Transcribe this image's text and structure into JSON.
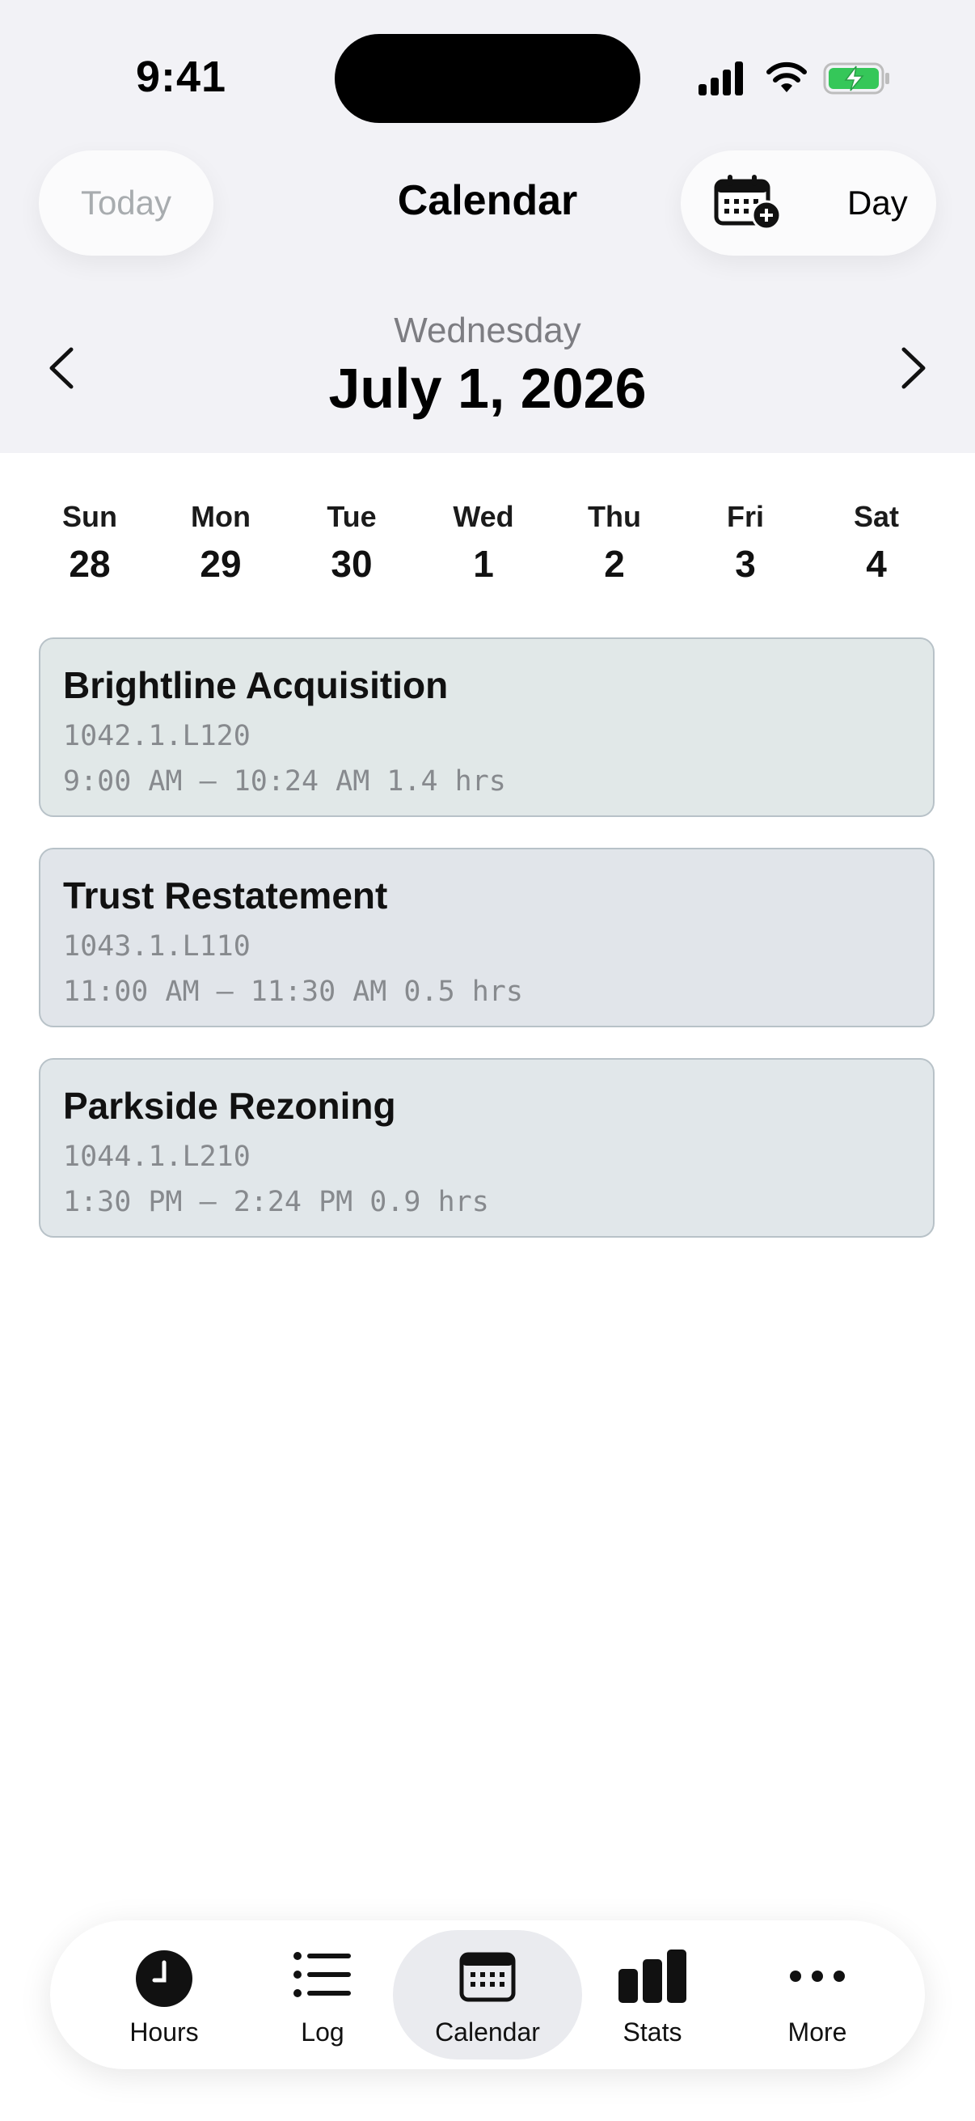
{
  "status_bar": {
    "time": "9:41"
  },
  "header": {
    "today_label": "Today",
    "title": "Calendar",
    "view_mode": "Day"
  },
  "date_nav": {
    "weekday": "Wednesday",
    "date": "July 1, 2026"
  },
  "week": [
    {
      "name": "Sun",
      "day": "28"
    },
    {
      "name": "Mon",
      "day": "29"
    },
    {
      "name": "Tue",
      "day": "30"
    },
    {
      "name": "Wed",
      "day": "1"
    },
    {
      "name": "Thu",
      "day": "2"
    },
    {
      "name": "Fri",
      "day": "3"
    },
    {
      "name": "Sat",
      "day": "4"
    }
  ],
  "events": [
    {
      "title": "Brightline Acquisition",
      "code": "1042.1.L120",
      "time": "9:00 AM — 10:24 AM 1.4 hrs",
      "color": "#e1e8e8"
    },
    {
      "title": "Trust Restatement",
      "code": "1043.1.L110",
      "time": "11:00 AM — 11:30 AM 0.5 hrs",
      "color": "#e1e5ea"
    },
    {
      "title": "Parkside Rezoning",
      "code": "1044.1.L210",
      "time": "1:30 PM — 2:24 PM 0.9 hrs",
      "color": "#e1e7ea"
    }
  ],
  "tabs": [
    {
      "label": "Hours",
      "icon": "clock-icon"
    },
    {
      "label": "Log",
      "icon": "list-icon"
    },
    {
      "label": "Calendar",
      "icon": "calendar-icon",
      "active": true
    },
    {
      "label": "Stats",
      "icon": "bar-chart-icon"
    },
    {
      "label": "More",
      "icon": "ellipsis-icon"
    }
  ],
  "colors": {
    "battery_fill": "#35c759",
    "header_background": "#f2f2f6",
    "active_tab_background": "#eaebef"
  }
}
